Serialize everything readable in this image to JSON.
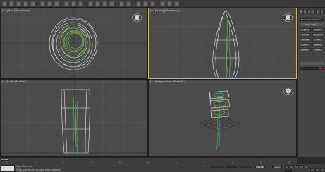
{
  "app": {
    "name": "3ds Max"
  },
  "viewports": {
    "top": {
      "label": "[+] [Top] [Wireframe]"
    },
    "front": {
      "label": "[+] [Front] [Wireframe]"
    },
    "left": {
      "label": "[+] [Left] [Realistic]"
    },
    "perspective": {
      "label": "[+] [Perspective] [Realistic]"
    }
  },
  "command_panel": {
    "category_dropdown": "Standard Primitives",
    "rollout_title": "Object Type",
    "buttons": [
      "Box",
      "Cone",
      "Sphere",
      "GeoSphere",
      "Cylinder",
      "Tube",
      "Torus",
      "Pyramid",
      "Teapot",
      "Plane"
    ],
    "name_color_hex": "#b33b3b"
  },
  "timeline": {
    "slider_label": "0 / 100",
    "ticks": [
      "0",
      "10",
      "20",
      "30",
      "40",
      "50",
      "60",
      "70",
      "80",
      "90",
      "100"
    ]
  },
  "status": {
    "line1": "None Selected",
    "line2": "Click or click-and-drag to select objects",
    "auto_key": "Auto Key",
    "set_key_dropdown": "Selected"
  },
  "colors": {
    "active_viewport_border": "#d7b83c",
    "viewport_bg": "#4b4b4b",
    "wire_white": "#e8e8e8",
    "wire_green": "#3fbf3f",
    "wire_cyan": "#4fd0e0",
    "wire_orange": "#d09030"
  }
}
